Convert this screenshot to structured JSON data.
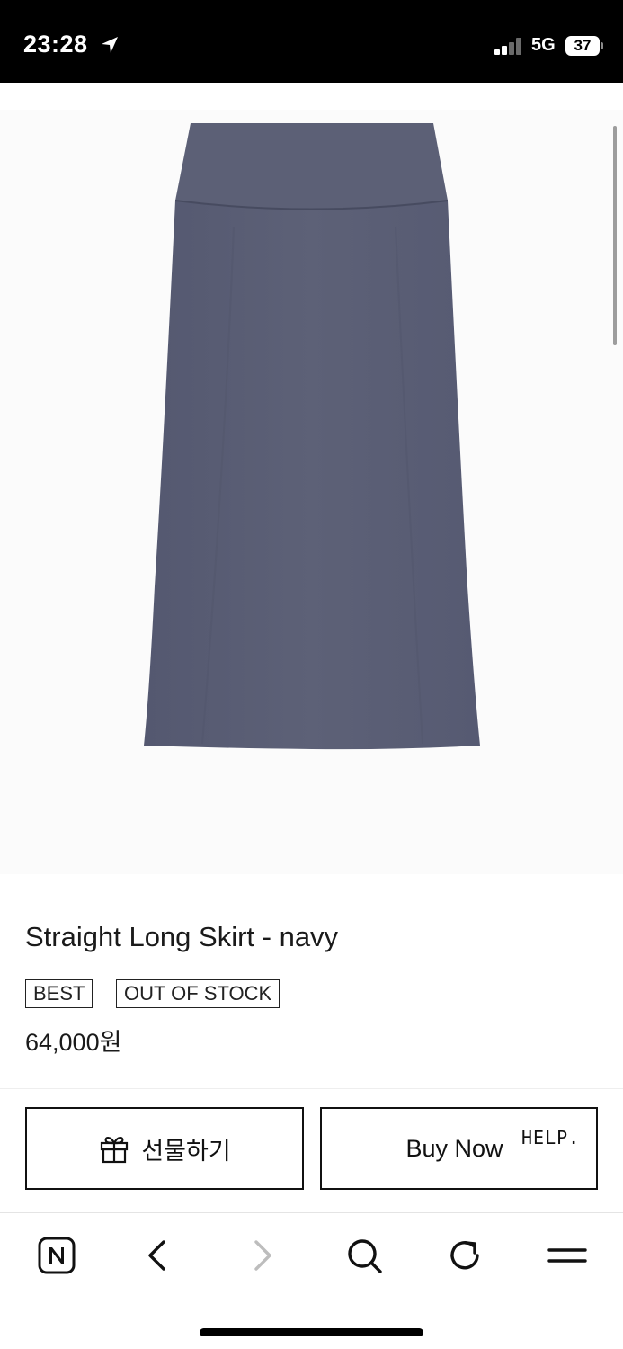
{
  "status_bar": {
    "time": "23:28",
    "network": "5G",
    "battery": "37",
    "signal_bars_filled": 2,
    "signal_bars_total": 4
  },
  "icons": {
    "location": "location-arrow-icon",
    "gift": "gift-icon",
    "naver": "naver-n-icon",
    "back": "chevron-left-icon",
    "forward": "chevron-right-icon",
    "search": "search-icon",
    "reload": "reload-icon",
    "menu": "menu-icon"
  },
  "product": {
    "image_color": "#5b5f75",
    "title": "Straight Long Skirt - navy",
    "badges": [
      "BEST",
      "OUT OF STOCK"
    ],
    "price": "64,000원"
  },
  "actions": {
    "gift_label": "선물하기",
    "buy_label": "Buy Now",
    "help_label": "HELP."
  },
  "colors": {
    "status_bg": "#000000",
    "skirt": "#5b5f75",
    "forward_disabled": "#bdbdbd"
  }
}
